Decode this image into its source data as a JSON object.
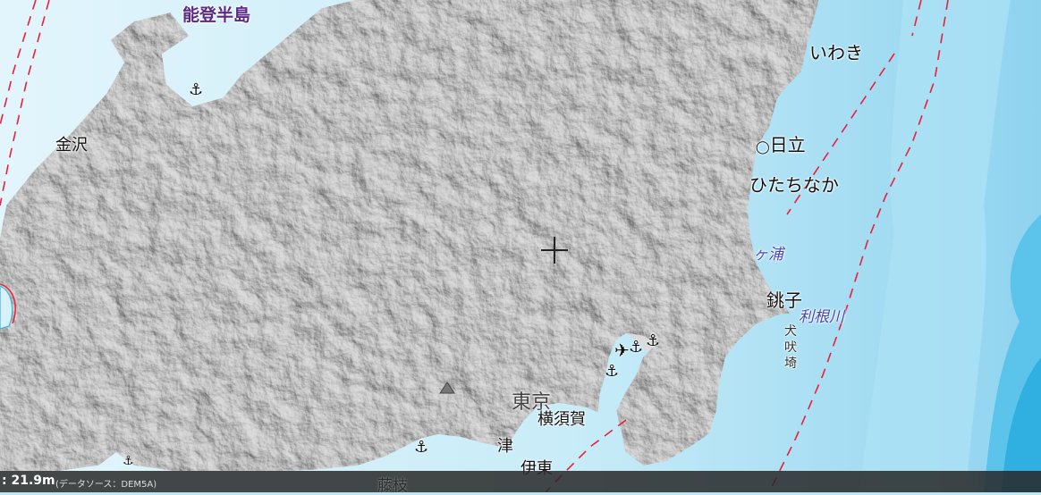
{
  "map": {
    "places": {
      "noto": "能登半島",
      "iwaki": "いわき",
      "kanazawa": "金沢",
      "hitachi": "日立",
      "hitachinaka": "ひたちなか",
      "kasumigaura": "ヶ浦",
      "choshi": "銚子",
      "tone": "利根川",
      "inubosaki": "犬吠埼",
      "yokosuka": "横須賀",
      "tokyo": "東京",
      "ito": "伊東",
      "numazu": "津",
      "fujieda": "藤枝"
    },
    "icons": {
      "port": "anchor-icon",
      "airport": "airplane-icon",
      "center": "crosshair-icon"
    },
    "colors": {
      "sea_shallow": "#e3f5fc",
      "sea_mid": "#bfe6f3",
      "sea_deep": "#2fb0e0",
      "land": "#a9a9a9",
      "boundary": "#e8203c",
      "coast": "#39b6d6"
    }
  },
  "status": {
    "elevation": ": 21.9m",
    "source": "(データソース：DEM5A)"
  }
}
